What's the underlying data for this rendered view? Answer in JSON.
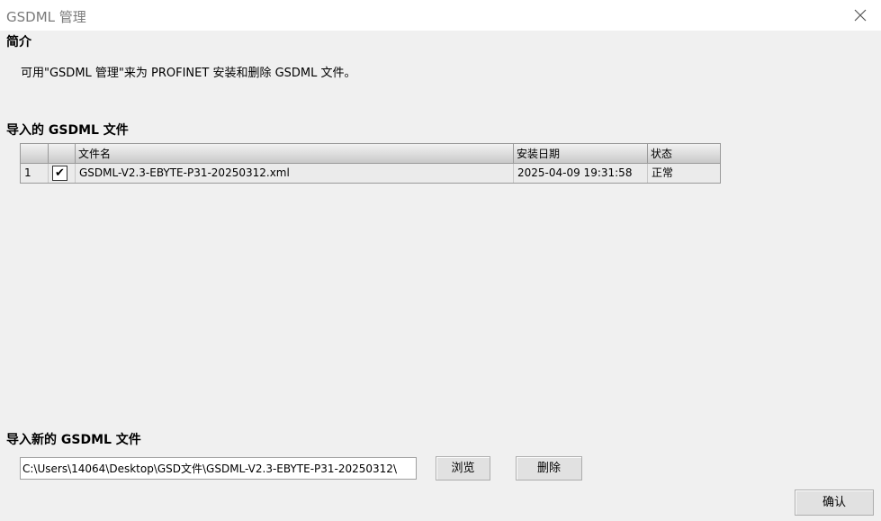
{
  "window": {
    "title": "GSDML 管理",
    "close_icon": "close-icon"
  },
  "intro": {
    "heading": "简介",
    "text": "可用\"GSDML 管理\"来为 PROFINET 安装和删除 GSDML 文件。"
  },
  "imported": {
    "heading": "导入的 GSDML 文件",
    "columns": [
      "",
      "",
      "文件名",
      "安装日期",
      "状态"
    ],
    "rows": [
      {
        "index": "1",
        "checked": true,
        "filename": "GSDML-V2.3-EBYTE-P31-20250312.xml",
        "install_date": "2025-04-09 19:31:58",
        "status": "正常"
      }
    ]
  },
  "import_new": {
    "heading": "导入新的 GSDML 文件",
    "path_value": "C:\\Users\\14064\\Desktop\\GSD文件\\GSDML-V2.3-EBYTE-P31-20250312\\",
    "browse_label": "浏览",
    "delete_label": "删除"
  },
  "footer": {
    "ok_label": "确认"
  },
  "checkmark": "✔"
}
